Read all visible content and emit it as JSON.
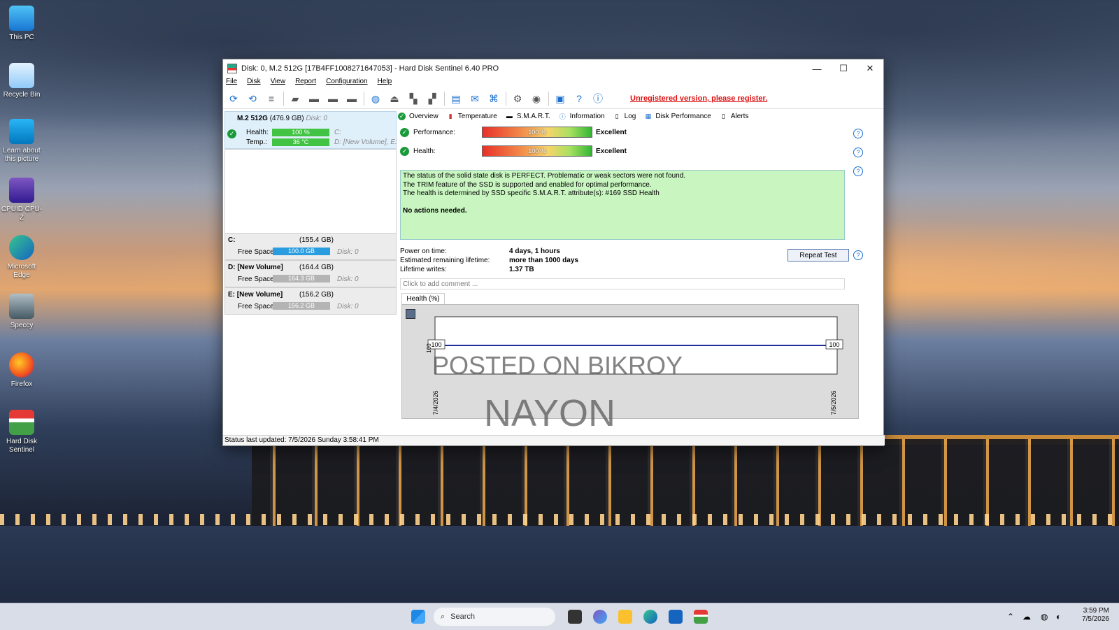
{
  "desktop": {
    "icons": [
      {
        "label": "This PC"
      },
      {
        "label": "Recycle Bin"
      },
      {
        "label": "Learn about this picture"
      },
      {
        "label": "CPUID CPU-Z"
      },
      {
        "label": "Microsoft Edge"
      },
      {
        "label": "Speccy"
      },
      {
        "label": "Firefox"
      },
      {
        "label": "Hard Disk Sentinel"
      }
    ]
  },
  "window": {
    "title": "Disk: 0, M.2 512G [17B4FF1008271647053]  -  Hard Disk Sentinel 6.40 PRO",
    "controls": {
      "minimize": "—",
      "maximize": "☐",
      "close": "✕"
    }
  },
  "menu": [
    "File",
    "Disk",
    "View",
    "Report",
    "Configuration",
    "Help"
  ],
  "toolbar": {
    "register_text": "Unregistered version, please register."
  },
  "left": {
    "disk": {
      "name": "M.2 512G",
      "size": "(476.9 GB)",
      "disk_label": "Disk: 0",
      "health_label": "Health:",
      "health_value": "100 %",
      "health_pct": 100,
      "health_drive": "C:",
      "temp_label": "Temp.:",
      "temp_value": "36 °C",
      "temp_drives": "D: [New Volume], E:"
    },
    "volumes": [
      {
        "name": "C:",
        "size": "(155.4 GB)",
        "free_label": "Free Space",
        "free_value": "100.0 GB",
        "disk": "Disk: 0"
      },
      {
        "name": "D: [New Volume]",
        "size": "(164.4 GB)",
        "free_label": "Free Space",
        "free_value": "164.3 GB",
        "disk": "Disk: 0"
      },
      {
        "name": "E: [New Volume]",
        "size": "(156.2 GB)",
        "free_label": "Free Space",
        "free_value": "156.2 GB",
        "disk": "Disk: 0"
      }
    ]
  },
  "tabs": [
    "Overview",
    "Temperature",
    "S.M.A.R.T.",
    "Information",
    "Log",
    "Disk Performance",
    "Alerts"
  ],
  "overview": {
    "performance_label": "Performance:",
    "performance_value": "100 %",
    "performance_text": "Excellent",
    "health_label": "Health:",
    "health_value": "100 %",
    "health_text": "Excellent",
    "status_lines": [
      "The status of the solid state disk is PERFECT. Problematic or weak sectors were not found.",
      "The TRIM feature of the SSD is supported and enabled for optimal performance.",
      "The health is determined by SSD specific S.M.A.R.T. attribute(s):  #169 SSD Health"
    ],
    "action_text": "No actions needed.",
    "power_on_label": "Power on time:",
    "power_on_value": "4 days, 1 hours",
    "remaining_label": "Estimated remaining lifetime:",
    "remaining_value": "more than 1000 days",
    "writes_label": "Lifetime writes:",
    "writes_value": "1.37 TB",
    "repeat_button": "Repeat Test",
    "comment_placeholder": "Click to add comment ...",
    "chart_tab": "Health (%)",
    "help_glyph": "?"
  },
  "chart_data": {
    "type": "line",
    "x": [
      "7/4/2026",
      "7/5/2026"
    ],
    "series": [
      {
        "values": [
          100,
          100
        ]
      }
    ],
    "point_labels": [
      "100",
      "100"
    ],
    "y_tick": "100",
    "ylim": [
      0,
      100
    ]
  },
  "status_bar": "Status last updated: 7/5/2026 Sunday 3:58:41 PM",
  "watermark": {
    "line1": "POSTED ON BIKROY",
    "line2": "NAYON"
  },
  "taskbar": {
    "search_placeholder": "Search",
    "time": "3:59 PM",
    "date": "7/5/2026"
  },
  "colors": {
    "accent": "#1a6fd1",
    "ok": "#1a9a3a",
    "status_bg": "#c8f5c0",
    "register": "#dd1111"
  }
}
